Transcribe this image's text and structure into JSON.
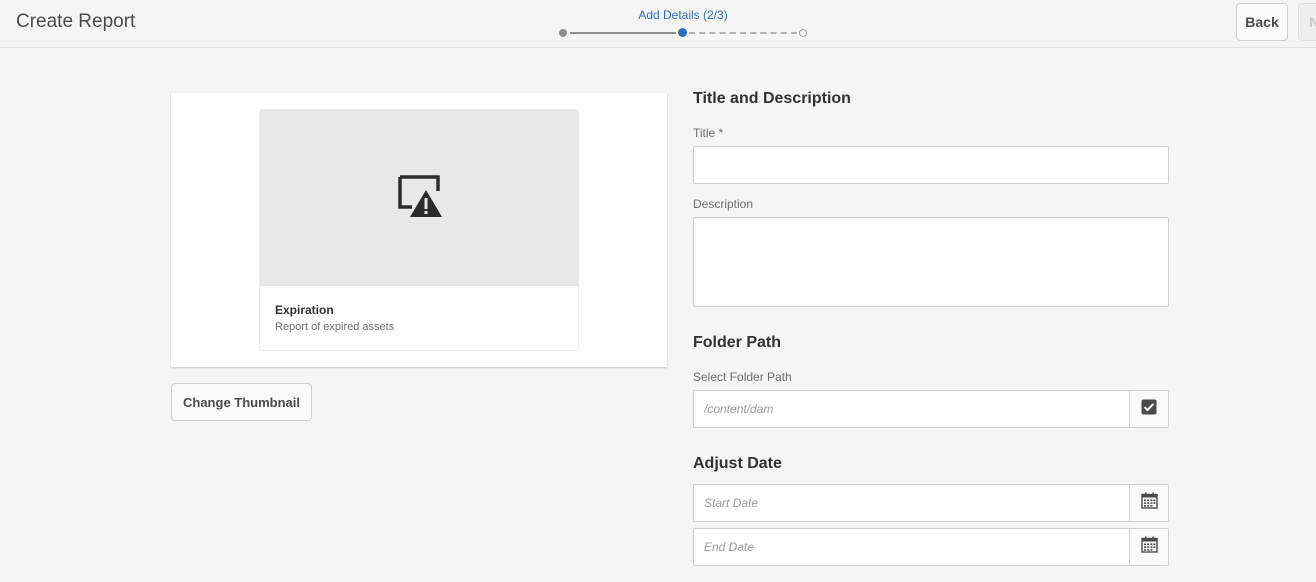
{
  "header": {
    "title": "Create Report",
    "wizard_step_label": "Add Details (2/3)",
    "back_label": "Back",
    "next_label": "N"
  },
  "card": {
    "title": "Expiration",
    "subtitle": "Report of expired assets",
    "thumbnail_icon": "image-missing-warning-icon"
  },
  "change_thumbnail_label": "Change Thumbnail",
  "title_section": {
    "heading": "Title and Description",
    "title_label": "Title *",
    "title_value": "",
    "description_label": "Description",
    "description_value": ""
  },
  "folder_section": {
    "heading": "Folder Path",
    "label": "Select Folder Path",
    "placeholder": "/content/dam",
    "button_icon": "checkbox-select-icon"
  },
  "date_section": {
    "heading": "Adjust Date",
    "start_placeholder": "Start Date",
    "end_placeholder": "End Date",
    "calendar_icon": "calendar-icon"
  },
  "colors": {
    "accent": "#2d6fba",
    "background": "#f5f5f5",
    "text": "#323232"
  }
}
